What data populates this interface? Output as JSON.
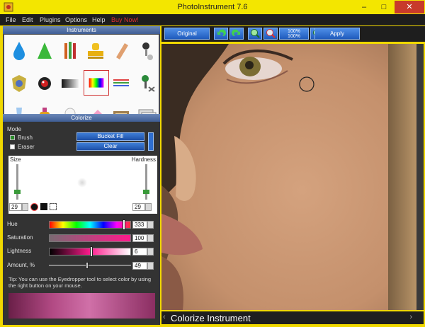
{
  "window": {
    "title": "PhotoInstrument 7.6",
    "minimize": "–",
    "maximize": "□",
    "close": "✕"
  },
  "menu": {
    "items": [
      "File",
      "Edit",
      "Plugins",
      "Options",
      "Help"
    ],
    "buy": "Buy Now!"
  },
  "instruments": {
    "header": "Instruments",
    "tools": [
      "droplet-icon",
      "cone-icon",
      "pencils-icon",
      "stamp-icon",
      "eraser-icon",
      "pin-icon",
      "shield-icon",
      "red-eye-icon",
      "gradient-icon",
      "rainbow-icon",
      "lines-icon",
      "joystick-icon",
      "tube-icon",
      "bottle-icon",
      "bulb-icon",
      "rubber-icon",
      "box-icon",
      "text-icon"
    ],
    "selected": 9
  },
  "colorize": {
    "header": "Colorize",
    "mode_label": "Mode",
    "brush": "Brush",
    "eraser": "Eraser",
    "bucket_fill": "Bucket Fill",
    "clear": "Clear",
    "size_label": "Size",
    "hardness_label": "Hardness",
    "size_value": "29",
    "hardness_value": "29",
    "hue_label": "Hue",
    "hue_value": "333",
    "saturation_label": "Saturation",
    "saturation_value": "100",
    "lightness_label": "Lightness",
    "lightness_value": "6",
    "amount_label": "Amount, %",
    "amount_value": "49",
    "tip": "Tip: You can use the Eyedropper tool to select color by using the right button on your mouse."
  },
  "toolbar": {
    "original": "Original",
    "zoom_top": "100%",
    "zoom_bottom": "100%",
    "apply": "Apply"
  },
  "status": {
    "text": "Colorize Instrument"
  },
  "colors": {
    "accent": "#2f6fd0",
    "buy": "#e03030",
    "close": "#c83a2b"
  }
}
